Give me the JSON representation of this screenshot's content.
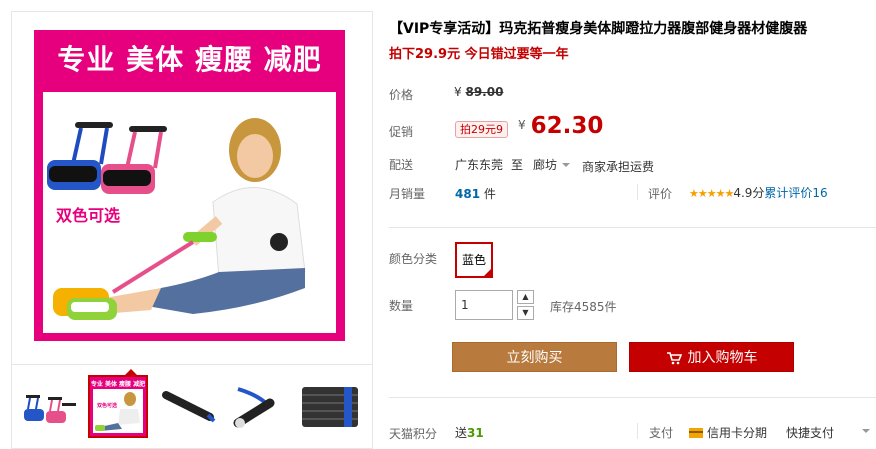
{
  "gallery": {
    "headline": "专业 美体 瘦腰 减肥",
    "colors_note": "双色可选",
    "thumbs_headline": "专业 美体 瘦腰 减肥",
    "thumbs_note": "双色可选"
  },
  "product": {
    "title": "【VIP专享活动】玛克拓普瘦身美体脚蹬拉力器腹部健身器材健腹器",
    "subtitle": "拍下29.9元 今日错过要等一年"
  },
  "price": {
    "label": "价格",
    "currency": "¥",
    "original": "89.00",
    "promo_label": "促销",
    "promo_badge": "拍29元9",
    "promo_currency": "¥",
    "promo_value": "62.30"
  },
  "delivery": {
    "label": "配送",
    "from": "广东东莞",
    "to_word": "至",
    "to": "廊坊",
    "fee": "商家承担运费"
  },
  "sales": {
    "label": "月销量",
    "count": "481",
    "unit": "件",
    "rating_label": "评价",
    "stars": "★★★★★",
    "score": "4.9分",
    "reviews": "累计评价16"
  },
  "options": {
    "color_label": "颜色分类",
    "color_value": "蓝色",
    "qty_label": "数量",
    "qty_value": "1",
    "up": "▲",
    "down": "▼",
    "stock": "库存4585件"
  },
  "actions": {
    "buy": "立刻购买",
    "cart": "加入购物车"
  },
  "footer": {
    "points_label": "天猫积分",
    "points_prefix": "送",
    "points_value": "31",
    "pay_label": "支付",
    "credit": "信用卡分期",
    "quick_pay": "快捷支付"
  },
  "colors": {
    "accent": "#c40000",
    "brand_pink": "#e6007e",
    "buy_button": "#b97a3e",
    "link": "#0067a8"
  }
}
